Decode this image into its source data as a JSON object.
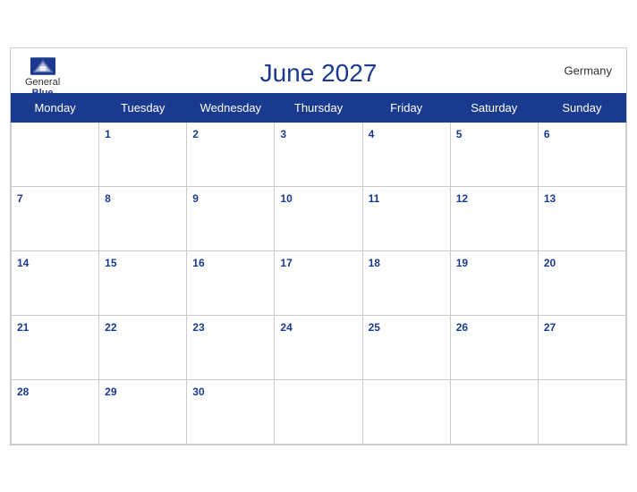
{
  "calendar": {
    "title": "June 2027",
    "country": "Germany",
    "logo": {
      "general": "General",
      "blue": "Blue"
    },
    "days_of_week": [
      "Monday",
      "Tuesday",
      "Wednesday",
      "Thursday",
      "Friday",
      "Saturday",
      "Sunday"
    ],
    "weeks": [
      [
        null,
        1,
        2,
        3,
        4,
        5,
        6
      ],
      [
        7,
        8,
        9,
        10,
        11,
        12,
        13
      ],
      [
        14,
        15,
        16,
        17,
        18,
        19,
        20
      ],
      [
        21,
        22,
        23,
        24,
        25,
        26,
        27
      ],
      [
        28,
        29,
        30,
        null,
        null,
        null,
        null
      ]
    ]
  }
}
